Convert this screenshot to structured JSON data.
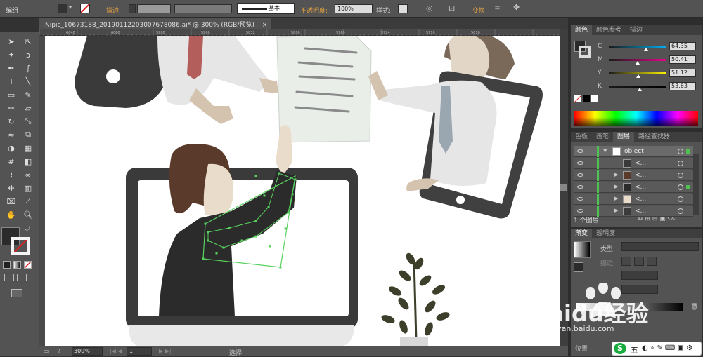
{
  "menu_label": "编组",
  "control_bar": {
    "stroke_label": "描边:",
    "stroke_profile": "基本",
    "opacity_label": "不透明度:",
    "opacity_value": "100%",
    "style_label": "样式:",
    "transform_label": "变换"
  },
  "document_tab": "Nipic_10673188_20190112203007678086.ai* @ 300% (RGB/预览)",
  "ruler_ticks": [
    "6040",
    "6060",
    "5980",
    "5900",
    "5832",
    "5800",
    "5760",
    "5724",
    "5710",
    "5616"
  ],
  "status_bar": {
    "zoom": "300%",
    "page": "1",
    "tool": "选择"
  },
  "color_panel": {
    "tabs": [
      "颜色",
      "颜色参考",
      "描边"
    ],
    "channels": [
      {
        "name": "C",
        "value": "64.35",
        "color": "#00aeef"
      },
      {
        "name": "M",
        "value": "50.41",
        "color": "#ec008c"
      },
      {
        "name": "Y",
        "value": "51.12",
        "color": "#fff200"
      },
      {
        "name": "K",
        "value": "53.63",
        "color": "#000000"
      }
    ]
  },
  "layers_panel": {
    "tabs": [
      "色板",
      "画笔",
      "图层",
      "路径查找器"
    ],
    "rows": [
      {
        "name": "object"
      },
      {
        "name": "<..."
      },
      {
        "name": "<..."
      },
      {
        "name": "<..."
      },
      {
        "name": "<..."
      },
      {
        "name": "<..."
      }
    ],
    "footer": "1 个图层"
  },
  "gradient_panel": {
    "tabs": [
      "渐变",
      "透明度"
    ],
    "type_label": "类型:",
    "stroke_label": "描边:",
    "position_label": "位置"
  },
  "watermark": {
    "brand": "Baidu经验",
    "url": "jingyan.baidu.com"
  },
  "ime": {
    "label": "五"
  }
}
